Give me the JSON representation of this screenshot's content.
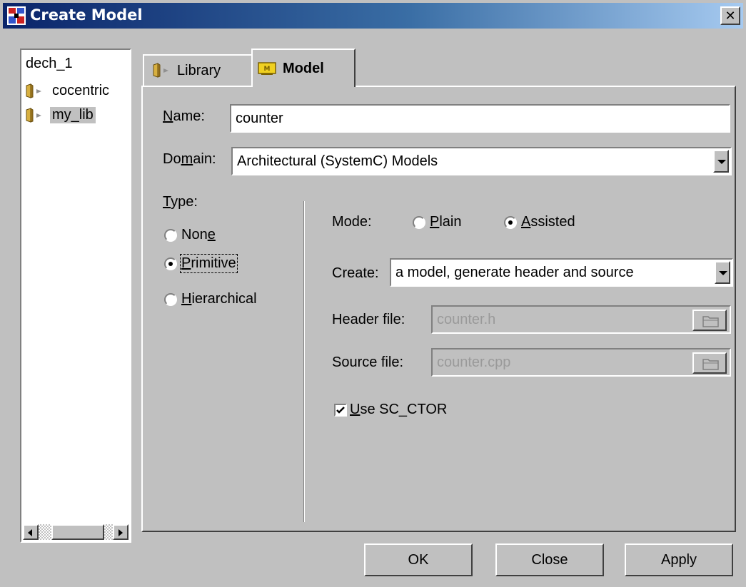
{
  "window": {
    "title": "Create Model",
    "close_label": "✕"
  },
  "tree": {
    "root": "dech_1",
    "items": [
      {
        "label": "cocentric",
        "selected": false
      },
      {
        "label": "my_lib",
        "selected": true
      }
    ]
  },
  "tabs": [
    {
      "label": "Library",
      "active": false
    },
    {
      "label": "Model",
      "active": true
    }
  ],
  "form": {
    "name": {
      "label_prefix": "",
      "label_mnemonic": "N",
      "label_rest": "ame:",
      "value": "counter"
    },
    "domain": {
      "label_prefix": "Do",
      "label_mnemonic": "m",
      "label_rest": "ain:",
      "value": "Architectural (SystemC) Models"
    },
    "type": {
      "label_mnemonic": "T",
      "label_rest": "ype:",
      "options": [
        {
          "prefix": "Non",
          "mnemonic": "e",
          "rest": "",
          "checked": false
        },
        {
          "prefix": "",
          "mnemonic": "P",
          "rest": "rimitive",
          "checked": true
        },
        {
          "prefix": "",
          "mnemonic": "H",
          "rest": "ierarchical",
          "checked": false
        }
      ]
    },
    "mode": {
      "label": "Mode:",
      "options": [
        {
          "mnemonic": "P",
          "rest": "lain",
          "checked": false
        },
        {
          "mnemonic": "A",
          "rest": "ssisted",
          "checked": true
        }
      ]
    },
    "create": {
      "label": "Create:",
      "value": "a model, generate header and source"
    },
    "header_file": {
      "label": "Header file:",
      "value": "counter.h"
    },
    "source_file": {
      "label": "Source file:",
      "value": "counter.cpp"
    },
    "use_sc_ctor": {
      "mnemonic": "U",
      "rest": "se SC_CTOR",
      "checked": true
    }
  },
  "buttons": {
    "ok": "OK",
    "close": "Close",
    "apply": "Apply"
  },
  "icons": {
    "title": "model-icon",
    "folder": "folder-icon",
    "tab_library": "library-icon",
    "tab_model": "model-tab-icon",
    "browse": "open-folder-icon",
    "scroll_left": "arrow-left-icon",
    "scroll_right": "arrow-right-icon"
  }
}
